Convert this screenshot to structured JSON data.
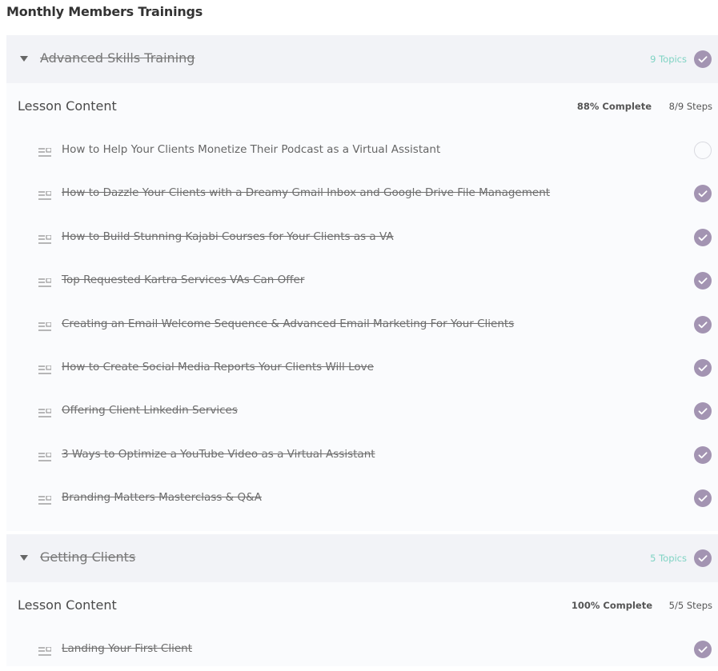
{
  "page_title": "Monthly Members Trainings",
  "colors": {
    "check_fill": "#a394b2",
    "topics_text": "#7fd3c3",
    "header_bg": "#f2f3f7"
  },
  "sections": [
    {
      "title": "Advanced Skills Training",
      "topics": "9 Topics",
      "completed": true,
      "lesson_label": "Lesson Content",
      "progress": "88% Complete",
      "steps": "8/9 Steps",
      "lessons": [
        {
          "title": "How to Help Your Clients Monetize Their Podcast as a Virtual Assistant",
          "done": false
        },
        {
          "title": "How to Dazzle Your Clients with a Dreamy Gmail Inbox and Google Drive File Management",
          "done": true
        },
        {
          "title": "How to Build Stunning Kajabi Courses for Your Clients as a VA",
          "done": true
        },
        {
          "title": "Top Requested Kartra Services VAs Can Offer",
          "done": true
        },
        {
          "title": "Creating an Email Welcome Sequence & Advanced Email Marketing For Your Clients",
          "done": true
        },
        {
          "title": "How to Create Social Media Reports Your Clients Will Love",
          "done": true
        },
        {
          "title": "Offering Client Linkedin Services",
          "done": true
        },
        {
          "title": "3 Ways to Optimize a YouTube Video as a Virtual Assistant",
          "done": true
        },
        {
          "title": "Branding Matters Masterclass & Q&A",
          "done": true
        }
      ]
    },
    {
      "title": "Getting Clients",
      "topics": "5 Topics",
      "completed": true,
      "lesson_label": "Lesson Content",
      "progress": "100% Complete",
      "steps": "5/5 Steps",
      "lessons": [
        {
          "title": "Landing Your First Client",
          "done": true
        }
      ]
    }
  ]
}
